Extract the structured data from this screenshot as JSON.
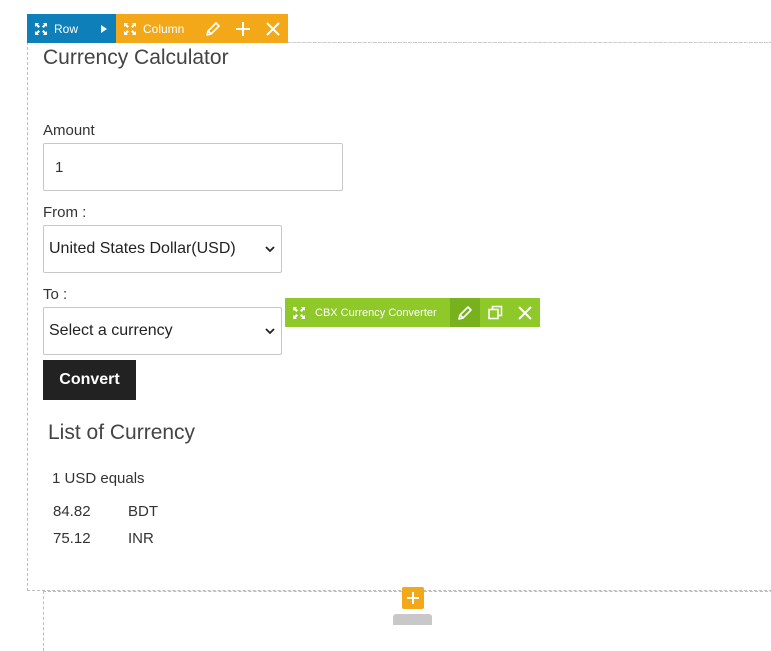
{
  "toolbar": {
    "row_label": "Row",
    "column_label": "Column",
    "widget_label": "CBX Currency Converter"
  },
  "calculator": {
    "title": "Currency Calculator",
    "amount_label": "Amount",
    "amount_value": "1",
    "from_label": "From :",
    "from_selected": "United States Dollar(USD)",
    "to_label": "To :",
    "to_selected": "Select a currency",
    "convert_label": "Convert"
  },
  "currency_list": {
    "title": "List of Currency",
    "base_text": "1 USD equals",
    "rates": [
      {
        "value": "84.82",
        "code": "BDT"
      },
      {
        "value": "75.12",
        "code": "INR"
      }
    ]
  },
  "colors": {
    "row_bar": "#0e7fb8",
    "column_bar": "#f2a818",
    "widget_bar": "#8ec829",
    "button": "#222222"
  },
  "icons": [
    "move-icon",
    "caret-right-icon",
    "pencil-icon",
    "plus-icon",
    "close-icon",
    "duplicate-icon",
    "chevron-down-icon"
  ]
}
